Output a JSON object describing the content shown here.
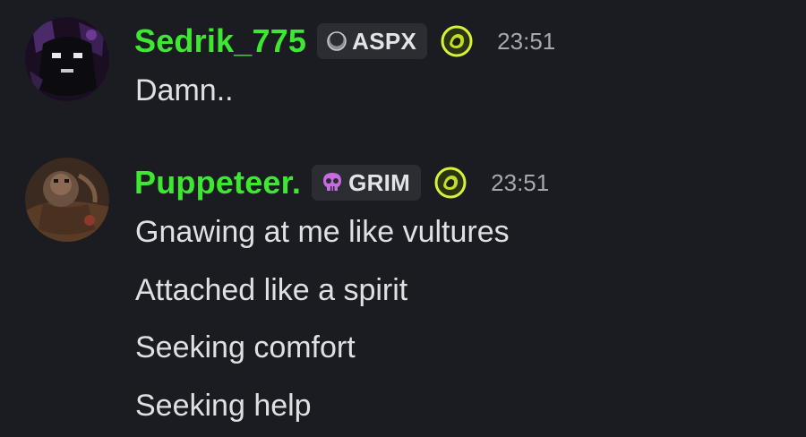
{
  "messages": [
    {
      "username": "Sedrik_775",
      "tag": {
        "text": "ASPX",
        "icon": "moon-crescent-icon"
      },
      "badge_icon": "glowing-orb-icon",
      "time": "23:51",
      "lines": [
        "Damn.."
      ]
    },
    {
      "username": "Puppeteer.",
      "tag": {
        "text": "GRIM",
        "icon": "skull-icon"
      },
      "badge_icon": "glowing-orb-icon",
      "time": "23:51",
      "lines": [
        "Gnawing at me like vultures",
        "Attached like a spirit",
        "Seeking comfort",
        "Seeking help"
      ]
    }
  ],
  "colors": {
    "background": "#1b1c21",
    "username": "#3ee832",
    "tag_background": "#2c2d33",
    "timestamp": "#a6a8b0",
    "message_text": "#dfe0e3",
    "grim_skull": "#c66be0",
    "badge_glow": "#d8f23a"
  }
}
